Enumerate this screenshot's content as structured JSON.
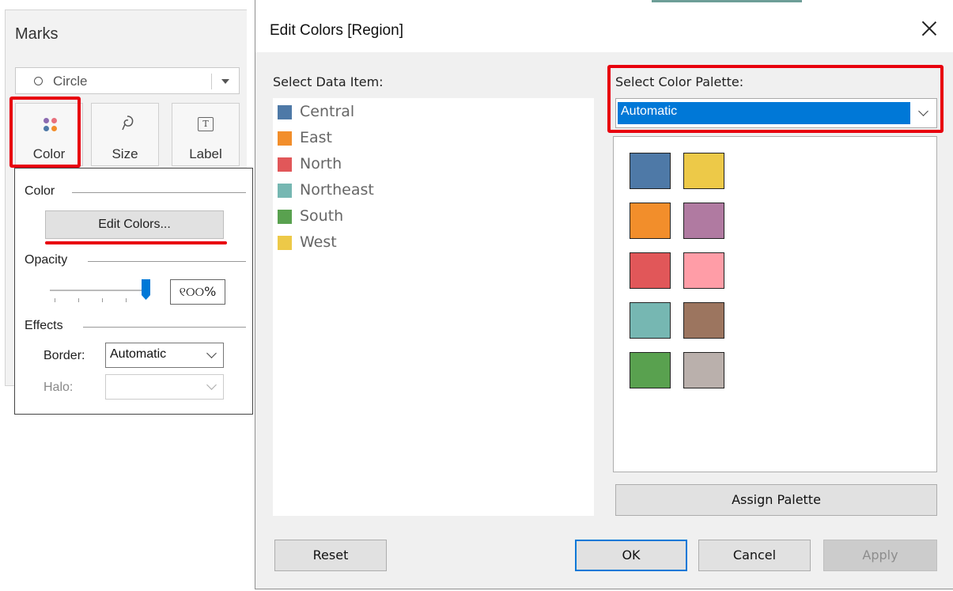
{
  "marks": {
    "title": "Marks",
    "mark_type": "Circle",
    "buttons": {
      "color": "Color",
      "size": "Size",
      "label": "Label"
    },
    "color_popup": {
      "color_section": "Color",
      "edit_colors": "Edit Colors...",
      "opacity_section": "Opacity",
      "opacity_value": "୧୦୦%",
      "opacity_level": 1.0,
      "effects_section": "Effects",
      "border_label": "Border:",
      "border_value": "Automatic",
      "halo_label": "Halo:",
      "halo_value": ""
    },
    "dot_colors": [
      "#8c6bb1",
      "#e8707d",
      "#4e79a7",
      "#f28e2b"
    ]
  },
  "dialog": {
    "title": "Edit Colors [Region]",
    "select_data_item_label": "Select Data Item:",
    "data_items": [
      {
        "name": "Central",
        "color": "#4e79a7"
      },
      {
        "name": "East",
        "color": "#f28e2b"
      },
      {
        "name": "North",
        "color": "#e15759"
      },
      {
        "name": "Northeast",
        "color": "#76b7b2"
      },
      {
        "name": "South",
        "color": "#59a14f"
      },
      {
        "name": "West",
        "color": "#edc948"
      }
    ],
    "select_palette_label": "Select Color Palette:",
    "palette_value": "Automatic",
    "palette_swatches": [
      "#4e79a7",
      "#edc948",
      "#f28e2b",
      "#b07aa1",
      "#e15759",
      "#ff9da7",
      "#76b7b2",
      "#9c755f",
      "#59a14f",
      "#bab0ac"
    ],
    "buttons": {
      "assign_palette": "Assign Palette",
      "reset": "Reset",
      "ok": "OK",
      "cancel": "Cancel",
      "apply": "Apply"
    }
  }
}
